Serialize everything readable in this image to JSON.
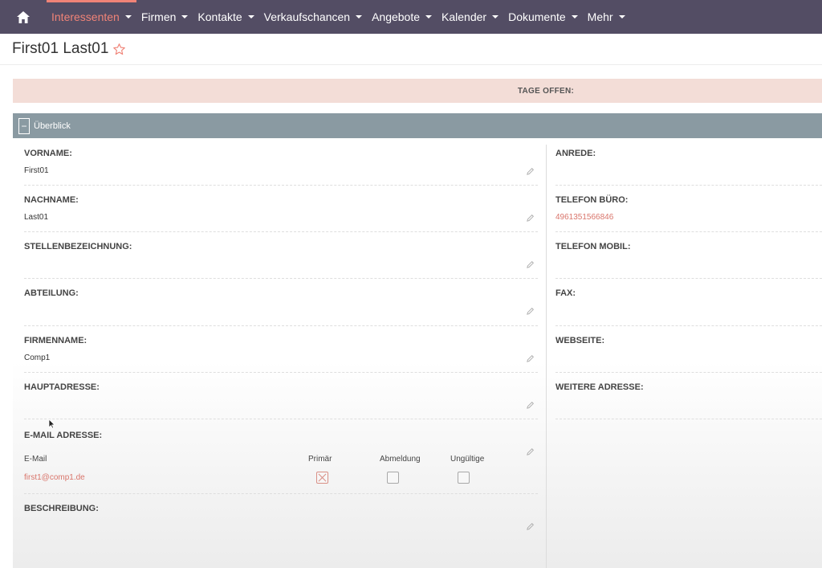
{
  "nav": {
    "items": [
      {
        "label": "Interessenten",
        "active": true
      },
      {
        "label": "Firmen"
      },
      {
        "label": "Kontakte"
      },
      {
        "label": "Verkaufschancen"
      },
      {
        "label": "Angebote"
      },
      {
        "label": "Kalender"
      },
      {
        "label": "Dokumente"
      },
      {
        "label": "Mehr"
      }
    ]
  },
  "record": {
    "title": "First01 Last01"
  },
  "banner": {
    "text": "TAGE OFFEN:"
  },
  "panel": {
    "title": "Überblick",
    "collapse_symbol": "−"
  },
  "fields": {
    "vorname": {
      "label": "VORNAME:",
      "value": "First01"
    },
    "nachname": {
      "label": "NACHNAME:",
      "value": "Last01"
    },
    "stellenbezeichnung": {
      "label": "STELLENBEZEICHNUNG:",
      "value": ""
    },
    "abteilung": {
      "label": "ABTEILUNG:",
      "value": ""
    },
    "firmenname": {
      "label": "FIRMENNAME:",
      "value": "Comp1"
    },
    "hauptadresse": {
      "label": "HAUPTADRESSE:",
      "value": ""
    },
    "email": {
      "label": "E-MAIL ADRESSE:",
      "col_email": "E-Mail",
      "col_primary": "Primär",
      "col_optout": "Abmeldung",
      "col_invalid": "Ungültige",
      "address": "first1@comp1.de",
      "primary": true,
      "optout": false,
      "invalid": false
    },
    "beschreibung": {
      "label": "BESCHREIBUNG:",
      "value": ""
    },
    "anrede": {
      "label": "ANREDE:",
      "value": ""
    },
    "telefon_buero": {
      "label": "TELEFON BÜRO:",
      "value": "4961351566846"
    },
    "telefon_mobil": {
      "label": "TELEFON MOBIL:",
      "value": ""
    },
    "fax": {
      "label": "FAX:",
      "value": ""
    },
    "webseite": {
      "label": "WEBSEITE:",
      "value": ""
    },
    "weitere_adresse": {
      "label": "WEITERE ADRESSE:",
      "value": ""
    }
  },
  "colors": {
    "nav_bg": "#534d64",
    "accent": "#f08377",
    "link": "#d9756b",
    "panel_header": "#8a9aa2",
    "banner_bg": "#f3ddd7"
  }
}
